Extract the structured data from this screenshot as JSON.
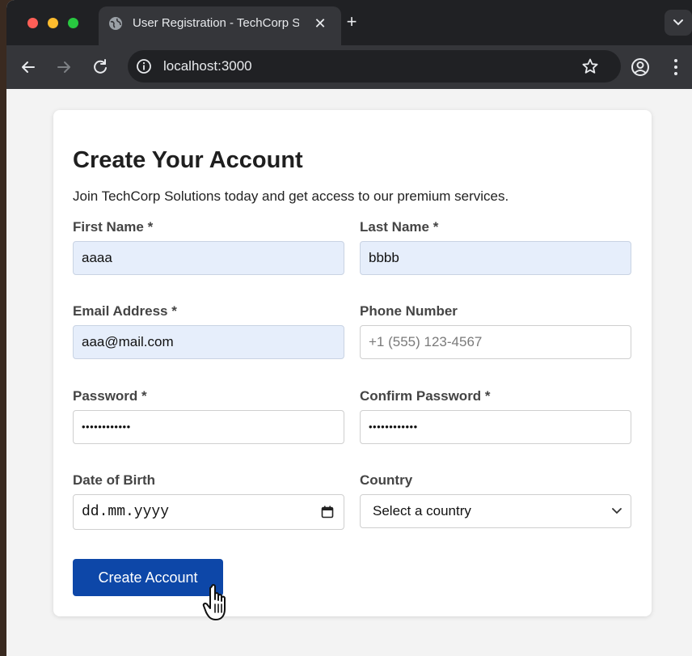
{
  "browser": {
    "tab_title": "User Registration - TechCorp Solutions",
    "tab_close": "✕",
    "new_tab": "+",
    "url": "localhost:3000"
  },
  "colors": {
    "primary_button": "#0d47a8",
    "autofill_bg": "#e6eefb"
  },
  "icons": {
    "back": "arrow-left",
    "forward": "arrow-right",
    "reload": "reload",
    "info": "info",
    "star": "bookmark-star",
    "profile": "account-circle",
    "menu": "kebab-menu",
    "tab_favicon": "globe",
    "date": "calendar",
    "select": "chevron-down",
    "cursor": "hand-pointer"
  },
  "form": {
    "title": "Create Your Account",
    "subtitle": "Join TechCorp Solutions today and get access to our premium services.",
    "first_name": {
      "label": "First Name *",
      "value": "aaaa"
    },
    "last_name": {
      "label": "Last Name *",
      "value": "bbbb"
    },
    "email": {
      "label": "Email Address *",
      "value": "aaa@mail.com"
    },
    "phone": {
      "label": "Phone Number",
      "value": "",
      "placeholder": "+1 (555) 123-4567"
    },
    "password": {
      "label": "Password *",
      "value": "••••••••••••"
    },
    "confirm_password": {
      "label": "Confirm Password *",
      "value": "••••••••••••"
    },
    "dob": {
      "label": "Date of Birth",
      "placeholder": "dd.mm.yyyy"
    },
    "country": {
      "label": "Country",
      "selected": "Select a country"
    },
    "submit_label": "Create Account"
  }
}
